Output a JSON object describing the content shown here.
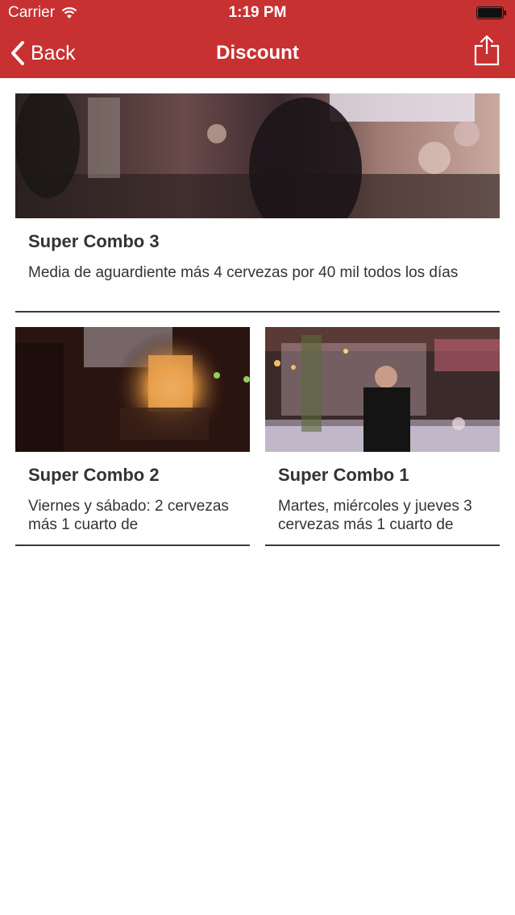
{
  "status_bar": {
    "carrier": "Carrier",
    "time": "1:19 PM",
    "wifi_icon": "wifi-icon",
    "battery_icon": "battery-icon"
  },
  "nav": {
    "back_label": "Back",
    "title": "Discount",
    "share_icon": "share-icon",
    "bar_color": "#c83131"
  },
  "cards": [
    {
      "title": "Super Combo 3",
      "description": "Media de aguardiente más 4 cervezas por 40 mil todos los días",
      "image_icon": "bar-photo-icon"
    },
    {
      "title": "Super Combo 2",
      "description": "Viernes y sábado:  2 cervezas más 1 cuarto de",
      "image_icon": "candle-photo-icon"
    },
    {
      "title": "Super Combo 1",
      "description": "Martes, miércoles y jueves 3 cervezas más 1 cuarto de",
      "image_icon": "bartender-photo-icon"
    }
  ]
}
